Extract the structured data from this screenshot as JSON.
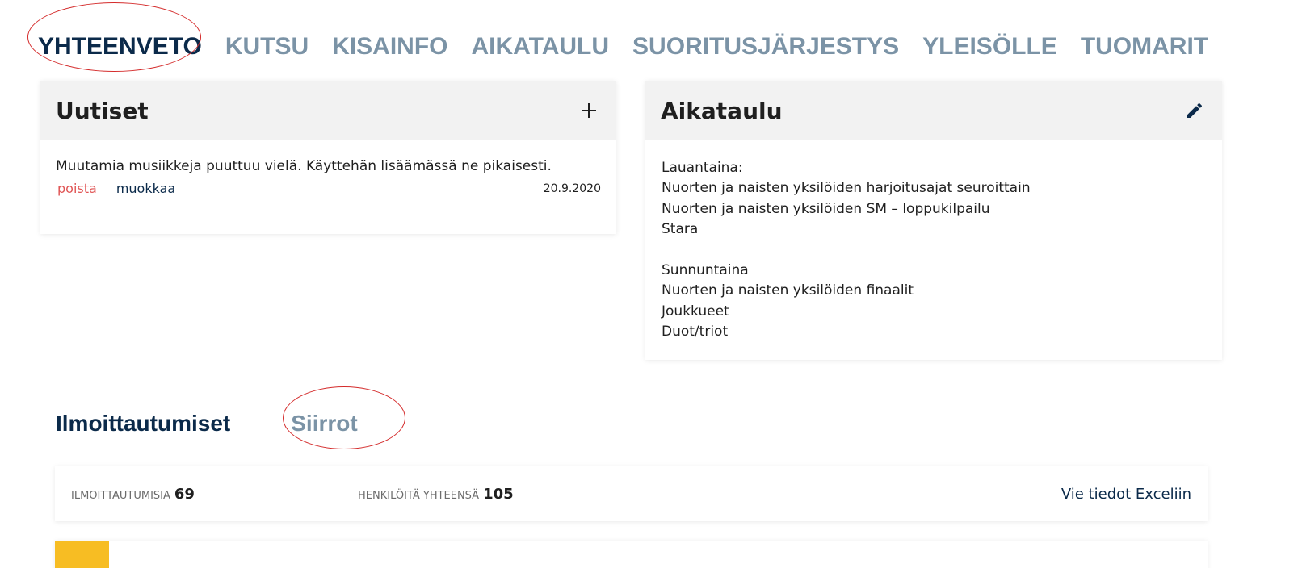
{
  "colors": {
    "tab_active": "#0b2a4a",
    "tab_inactive": "#7b93a6",
    "delete": "#e05555",
    "accent": "#f7bd23",
    "annotation": "#d42b2b"
  },
  "topnav": {
    "tabs": [
      "YHTEENVETO",
      "KUTSU",
      "KISAINFO",
      "AIKATAULU",
      "SUORITUSJÄRJESTYS",
      "YLEISÖLLE",
      "TUOMARIT"
    ]
  },
  "news": {
    "title": "Uutiset",
    "add_icon": "plus-icon",
    "items": [
      {
        "text": "Muutamia musiikkeja puuttuu vielä. Käyttehän lisäämässä ne pikaisesti.",
        "delete_label": "poista",
        "edit_label": "muokkaa",
        "date": "20.9.2020"
      }
    ]
  },
  "schedule": {
    "title": "Aikataulu",
    "edit_icon": "pencil-icon",
    "lines": [
      "Lauantaina:",
      "Nuorten ja naisten yksilöiden harjoitusajat seuroittain",
      "Nuorten ja naisten yksilöiden SM – loppukilpailu",
      "Stara",
      "",
      "Sunnuntaina",
      "Nuorten ja naisten yksilöiden finaalit",
      "Joukkueet",
      "Duot/triot"
    ]
  },
  "subtabs": {
    "active": "Ilmoittautumiset",
    "inactive": "Siirrot"
  },
  "stats": {
    "registrations_label": "ILMOITTAUTUMISIA",
    "registrations_value": "69",
    "persons_label": "HENKILÖITÄ YHTEENSÄ",
    "persons_value": "105",
    "export_label": "Vie tiedot Exceliin"
  }
}
